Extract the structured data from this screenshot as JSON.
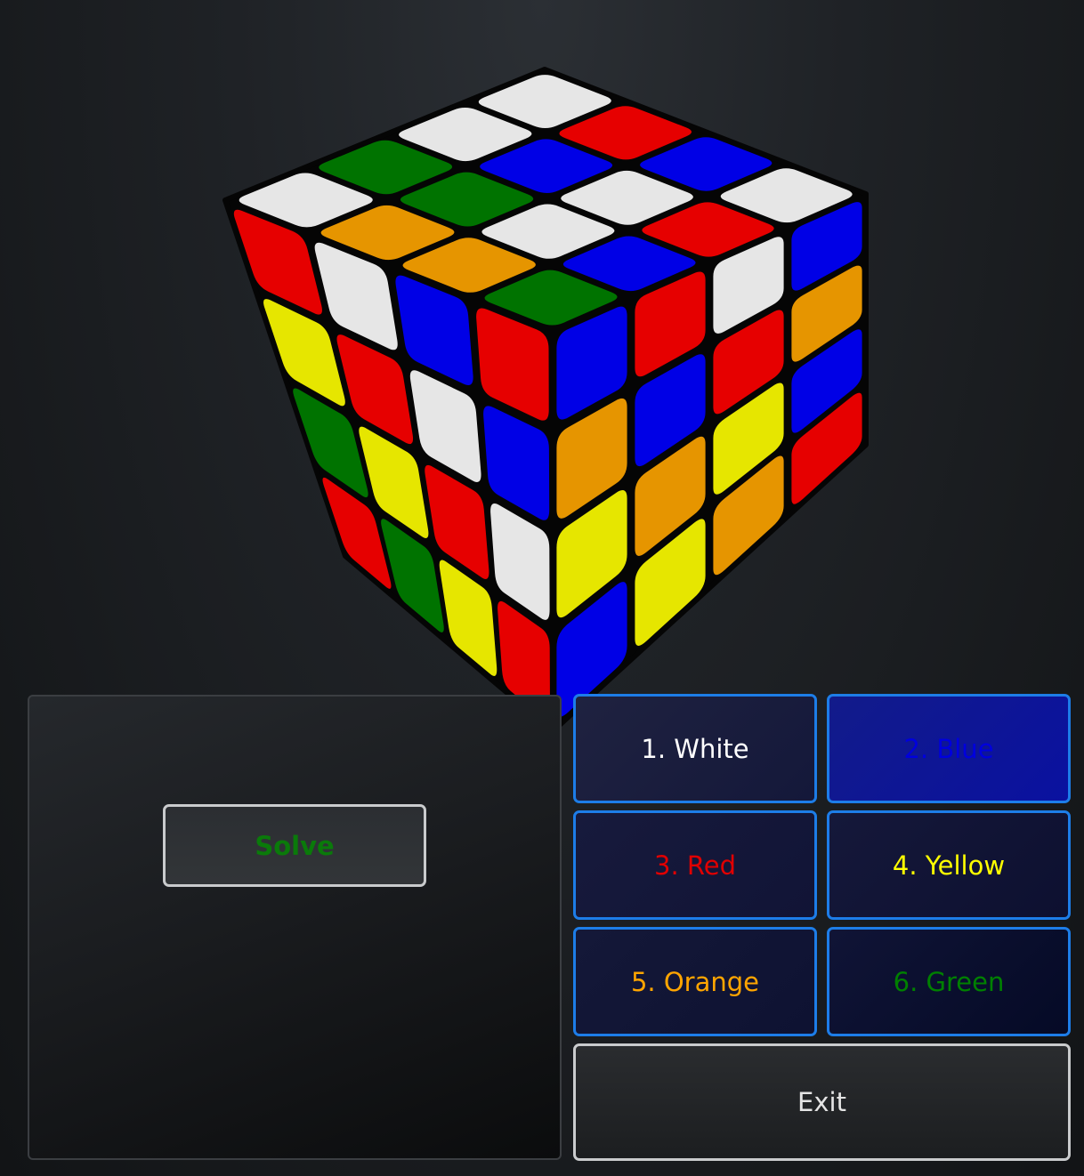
{
  "cube": {
    "colors": {
      "W": "#e6e6e6",
      "B": "#0000e6",
      "R": "#e60000",
      "Y": "#e6e600",
      "O": "#e69500",
      "G": "#007300"
    },
    "stickers": [
      [
        "W",
        "O",
        "O",
        "G",
        "G",
        "G",
        "W",
        "B",
        "W",
        "B",
        "W",
        "R",
        "W",
        "R",
        "B",
        "W"
      ],
      [
        "R",
        "W",
        "B",
        "R",
        "Y",
        "R",
        "W",
        "B",
        "G",
        "Y",
        "R",
        "W",
        "R",
        "G",
        "Y",
        "R"
      ],
      [
        "B",
        "R",
        "W",
        "B",
        "O",
        "B",
        "R",
        "O",
        "Y",
        "O",
        "Y",
        "B",
        "B",
        "Y",
        "O",
        "R"
      ]
    ]
  },
  "solve": {
    "label": "Solve",
    "color": "#0a7a0a"
  },
  "color_buttons": [
    {
      "label": "1. White",
      "text_color": "#ffffff"
    },
    {
      "label": "2. Blue",
      "text_color": "#0000dd"
    },
    {
      "label": "3. Red",
      "text_color": "#e00000"
    },
    {
      "label": "4. Yellow",
      "text_color": "#ffff00"
    },
    {
      "label": "5. Orange",
      "text_color": "#ffa500"
    },
    {
      "label": "6. Green",
      "text_color": "#008000"
    }
  ],
  "exit": {
    "label": "Exit"
  }
}
